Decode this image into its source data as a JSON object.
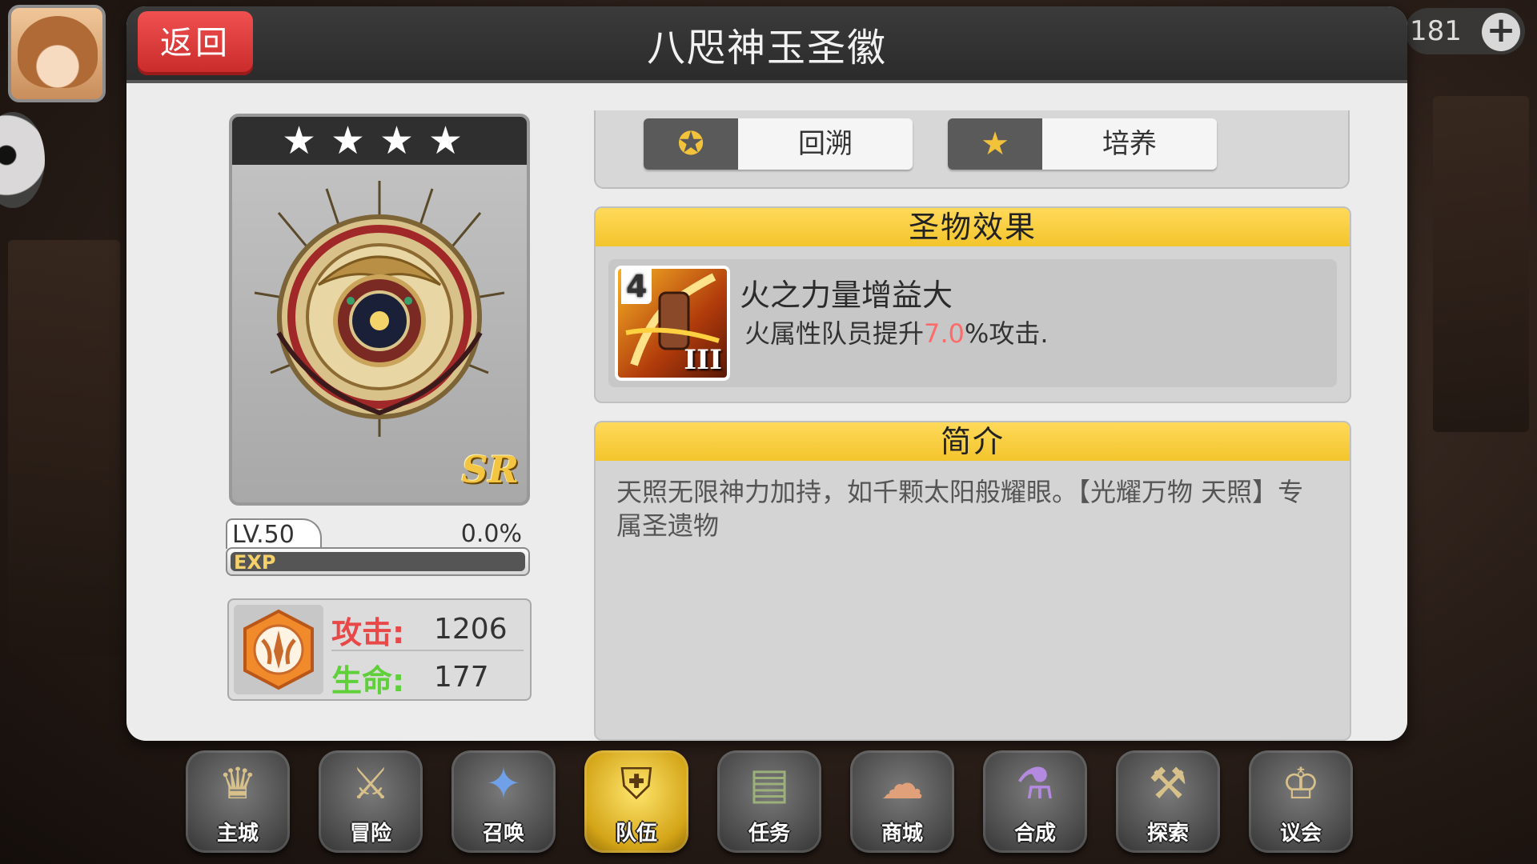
{
  "top": {
    "currency_value": "181",
    "add_label": "+"
  },
  "panel": {
    "title": "八咫神玉圣徽",
    "back_label": "返回"
  },
  "relic": {
    "stars": "★★★★",
    "rarity": "SR",
    "level_text": "LV.50",
    "exp_percent_text": "0.0%",
    "exp_fraction": 0.0,
    "exp_label": "EXP",
    "stats": {
      "attack_label": "攻击:",
      "attack_value": "1206",
      "hp_label": "生命:",
      "hp_value": "177"
    }
  },
  "tabs": [
    {
      "label": "回溯",
      "icon": "star-arrow-icon"
    },
    {
      "label": "培养",
      "icon": "star-wings-icon"
    }
  ],
  "effect": {
    "header": "圣物效果",
    "item_level": "4",
    "item_rank": "III",
    "name": "火之力量增益大",
    "desc_prefix": "火属性队员提升",
    "desc_value": "7.0",
    "desc_suffix": "%攻击."
  },
  "intro": {
    "header": "简介",
    "text": "天照无限神力加持，如千颗太阳般耀眼。【光耀万物 天照】专属圣遗物"
  },
  "colors": {
    "accent_yellow": "#f3c52c",
    "back_red": "#e03c3c",
    "attack_red": "#e84848",
    "hp_green": "#5fcf3a",
    "highlight": "#ff6b6b"
  },
  "nav": [
    {
      "label": "主城",
      "icon": "crown-icon"
    },
    {
      "label": "冒险",
      "icon": "axe-icon"
    },
    {
      "label": "召唤",
      "icon": "summon-card-icon"
    },
    {
      "label": "队伍",
      "icon": "winged-shield-icon",
      "active": true
    },
    {
      "label": "任务",
      "icon": "book-icon"
    },
    {
      "label": "商城",
      "icon": "tree-icon"
    },
    {
      "label": "合成",
      "icon": "potion-icon"
    },
    {
      "label": "探索",
      "icon": "shovel-icon"
    },
    {
      "label": "议会",
      "icon": "council-crown-icon"
    }
  ]
}
